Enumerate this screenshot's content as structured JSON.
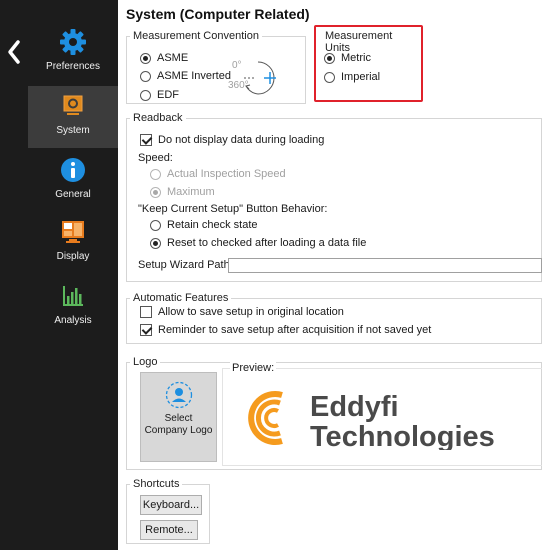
{
  "sidebar": {
    "items": [
      {
        "label": "Preferences",
        "icon": "gear-icon"
      },
      {
        "label": "System",
        "icon": "system-icon"
      },
      {
        "label": "General",
        "icon": "info-icon"
      },
      {
        "label": "Display",
        "icon": "display-icon"
      },
      {
        "label": "Analysis",
        "icon": "bar-chart-icon"
      }
    ],
    "active": "System",
    "accent": "#1e8fe0"
  },
  "page": {
    "title": "System (Computer Related)"
  },
  "measurement_convention": {
    "legend": "Measurement Convention",
    "options": [
      "ASME",
      "ASME Inverted",
      "EDF"
    ],
    "selected": "ASME",
    "diagram": {
      "angle_top": "0°",
      "angle_bottom": "360°",
      "sign": "+"
    }
  },
  "measurement_units": {
    "legend": "Measurement Units",
    "options": [
      "Metric",
      "Imperial"
    ],
    "selected": "Metric",
    "highlight_color": "#e0212b"
  },
  "readback": {
    "legend": "Readback",
    "no_display_label": "Do not display data during loading",
    "no_display_checked": true,
    "speed_label": "Speed:",
    "speed_options": [
      "Actual Inspection Speed",
      "Maximum"
    ],
    "speed_selected": "Maximum",
    "keep_setup_label": "\"Keep Current Setup\" Button Behavior:",
    "keep_options": [
      "Retain check state",
      "Reset to checked after loading a data file"
    ],
    "keep_selected": "Reset to checked after loading a data file",
    "wizard_path_label": "Setup Wizard Path:",
    "wizard_path_value": ""
  },
  "automatic_features": {
    "legend": "Automatic Features",
    "allow_save_label": "Allow to save setup in original location",
    "allow_save_checked": false,
    "reminder_label": "Reminder to save setup after acquisition if not saved yet",
    "reminder_checked": true
  },
  "logo": {
    "legend": "Logo",
    "select_label_line1": "Select",
    "select_label_line2": "Company Logo",
    "preview_label": "Preview:",
    "company_name_line1": "Eddyfi",
    "company_name_line2": "Technologies",
    "brand_color": "#f59b1e",
    "text_color": "#4a4a4a"
  },
  "shortcuts": {
    "legend": "Shortcuts",
    "keyboard_label": "Keyboard...",
    "remote_label": "Remote..."
  }
}
